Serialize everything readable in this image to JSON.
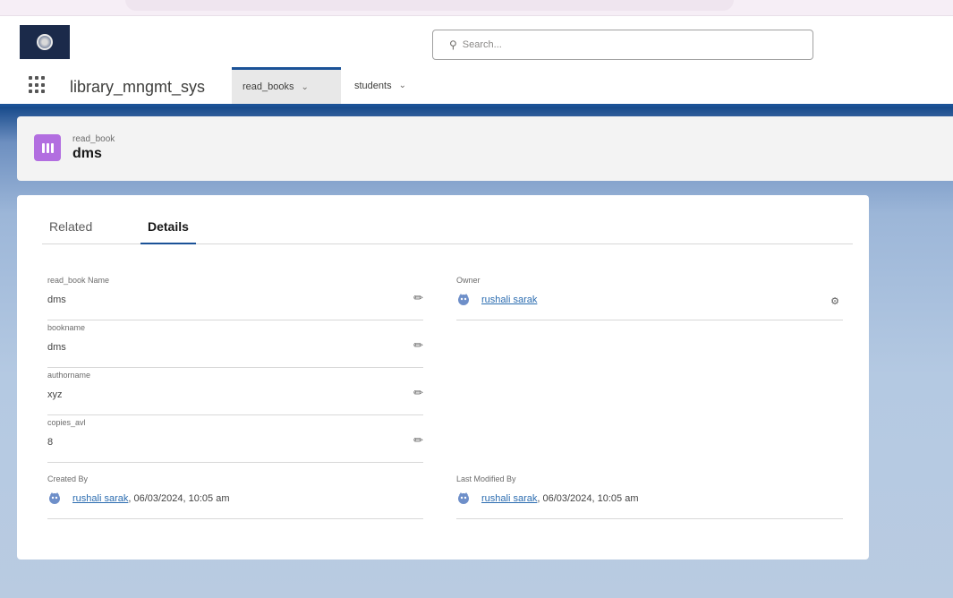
{
  "header": {
    "search_placeholder": "Search..."
  },
  "nav": {
    "app_name": "library_mngmt_sys",
    "tabs": [
      {
        "label": "read_books",
        "active": true
      },
      {
        "label": "students",
        "active": false
      }
    ]
  },
  "record": {
    "type": "read_book",
    "name": "dms"
  },
  "record_tabs": {
    "related": "Related",
    "details": "Details"
  },
  "fields": {
    "read_book_name": {
      "label": "read_book Name",
      "value": "dms"
    },
    "bookname": {
      "label": "bookname",
      "value": "dms"
    },
    "authorname": {
      "label": "authorname",
      "value": "xyz"
    },
    "copies_avl": {
      "label": "copies_avl",
      "value": "8"
    },
    "owner": {
      "label": "Owner",
      "value": "rushali sarak"
    },
    "created_by": {
      "label": "Created By",
      "user": "rushali sarak",
      "timestamp": ", 06/03/2024, 10:05 am"
    },
    "last_modified_by": {
      "label": "Last Modified By",
      "user": "rushali sarak",
      "timestamp": ", 06/03/2024, 10:05 am"
    }
  },
  "colors": {
    "brand_blue": "#1b5297",
    "record_icon": "#b26ee0",
    "link": "#2b6cb0"
  },
  "icons": {
    "logo": "org-logo-icon",
    "search": "search-icon",
    "app_launcher": "app-launcher-icon",
    "record": "custom-object-icon",
    "edit": "pencil-icon",
    "user": "user-avatar-icon",
    "change_owner": "change-owner-icon"
  }
}
